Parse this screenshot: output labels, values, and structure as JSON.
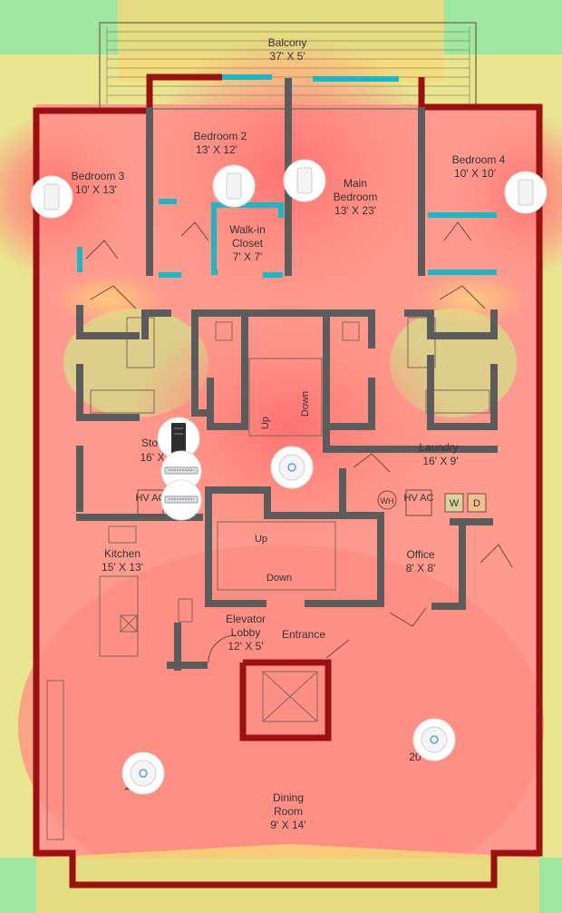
{
  "rooms": {
    "balcony": {
      "name": "Balcony",
      "size": "37' X 5'"
    },
    "bedroom2": {
      "name": "Bedroom 2",
      "size": "13' X 12'"
    },
    "bedroom3": {
      "name": "Bedroom 3",
      "size": "10' X 13'"
    },
    "bedroom4": {
      "name": "Bedroom 4",
      "size": "10' X 10'"
    },
    "main_bedroom": {
      "name1": "Main",
      "name2": "Bedroom",
      "size": "13' X 23'"
    },
    "walkin": {
      "name1": "Walk-in",
      "name2": "Closet",
      "size": "7' X 7'"
    },
    "storage": {
      "name": "Sto",
      "size": "16' X"
    },
    "laundry": {
      "name": "Laundry",
      "size": "16' X 9'"
    },
    "kitchen": {
      "name": "Kitchen",
      "size": "15' X 13'"
    },
    "office": {
      "name": "Office",
      "size": "8' X 8'"
    },
    "elevator_lobby": {
      "name1": "Elevator",
      "name2": "Lobby",
      "size": "12' X 5'"
    },
    "entrance": {
      "name": "Entrance"
    },
    "dining": {
      "name": "Dining",
      "name2": "Room",
      "size": "9' X 14'"
    },
    "living_left_partial": {
      "text": "1"
    },
    "living_right_partial": {
      "text": "20"
    }
  },
  "fixtures": {
    "hvac": "HV AC",
    "wh": "WH",
    "washer": "W",
    "dryer": "D",
    "stairs_up": "Up",
    "stairs_down": "Down"
  },
  "colors": {
    "outer_wall": "#9b1010",
    "interior_wall": "#5c5c5c",
    "glass_wall": "#19b8c8",
    "heat_strong": "#ff8a80",
    "heat_mid": "#f6d878",
    "heat_weak": "#9fe6a0"
  },
  "devices": {
    "wall_aps": [
      "bedroom3-access-point",
      "bedroom2-access-point",
      "main-bedroom-access-point",
      "bedroom4-access-point"
    ],
    "ceiling_aps": [
      "hall-access-point",
      "living-access-point",
      "dining-right-access-point"
    ],
    "rack": [
      "network-rack",
      "switch-1",
      "switch-2"
    ]
  }
}
